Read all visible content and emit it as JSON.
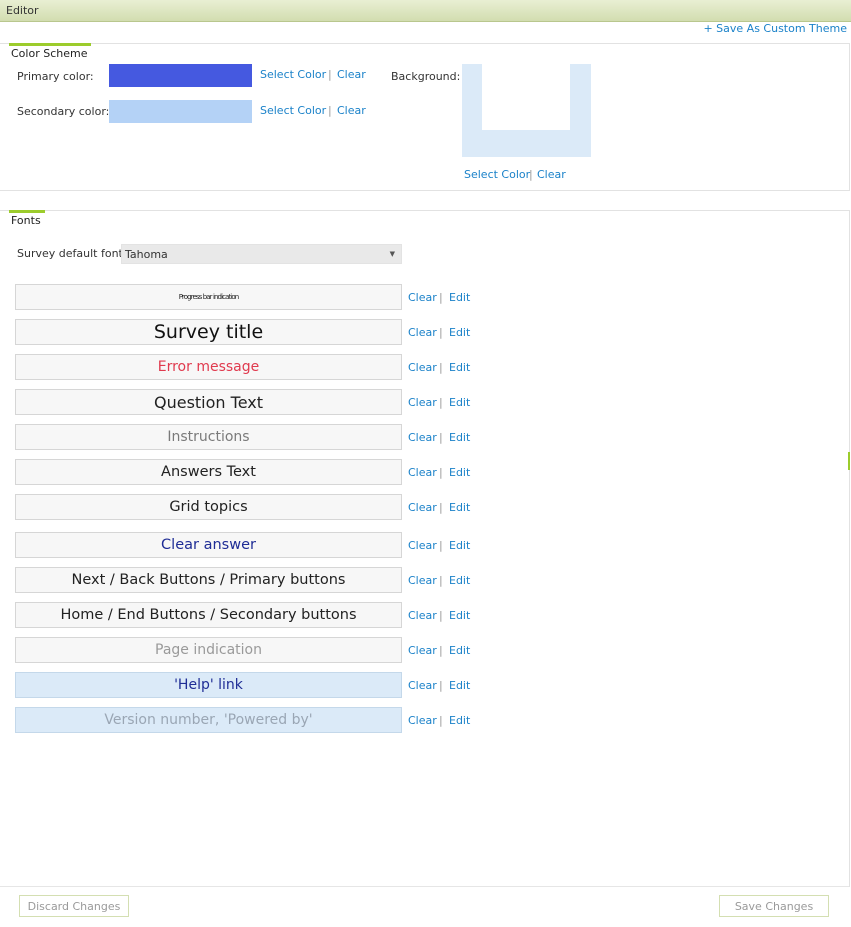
{
  "window": {
    "title": "Editor"
  },
  "actions": {
    "save_custom_theme": "+ Save As Custom Theme"
  },
  "color_scheme": {
    "tab_label": "Color Scheme",
    "primary": {
      "label": "Primary color:",
      "color": "#4559e0"
    },
    "secondary": {
      "label": "Secondary color:",
      "color": "#b4d2f6"
    },
    "background": {
      "label": "Background:",
      "color": "#dbeaf8"
    },
    "select_label": "Select Color",
    "clear_label": "Clear",
    "separator": "|"
  },
  "fonts": {
    "tab_label": "Fonts",
    "default_font_label": "Survey default font",
    "default_font_value": "Tahoma",
    "clear_label": "Clear",
    "edit_label": "Edit",
    "separator": "|",
    "items": [
      {
        "label": "Progress bar indication",
        "color": "#222222",
        "size": "7px",
        "letter_spacing": "-0.9px",
        "style": "plain"
      },
      {
        "label": "Survey title",
        "color": "#111111",
        "size": "19px",
        "style": "plain"
      },
      {
        "label": "Error message",
        "color": "#e03a4e",
        "size": "14px",
        "style": "plain"
      },
      {
        "label": "Question Text",
        "color": "#222222",
        "size": "16px",
        "style": "plain"
      },
      {
        "label": "Instructions",
        "color": "#7a7a7a",
        "size": "14px",
        "style": "plain"
      },
      {
        "label": "Answers Text",
        "color": "#222222",
        "size": "14.5px",
        "style": "plain"
      },
      {
        "label": "Grid topics",
        "color": "#222222",
        "size": "14.5px",
        "style": "plain"
      },
      {
        "label": "Clear answer",
        "color": "#1f2d96",
        "size": "14.5px",
        "style": "plain"
      },
      {
        "label": "Next / Back Buttons / Primary buttons",
        "color": "#222222",
        "size": "14.5px",
        "style": "plain"
      },
      {
        "label": "Home / End Buttons / Secondary buttons",
        "color": "#222222",
        "size": "14.5px",
        "style": "plain"
      },
      {
        "label": "Page indication",
        "color": "#9a9a9a",
        "size": "14px",
        "style": "plain"
      },
      {
        "label": "'Help' link",
        "color": "#1f2d96",
        "size": "14px",
        "style": "blue"
      },
      {
        "label": "Version number, 'Powered by'",
        "color": "#9aa6b4",
        "size": "14px",
        "style": "blue"
      }
    ]
  },
  "footer": {
    "discard_label": "Discard Changes",
    "save_label": "Save Changes"
  }
}
